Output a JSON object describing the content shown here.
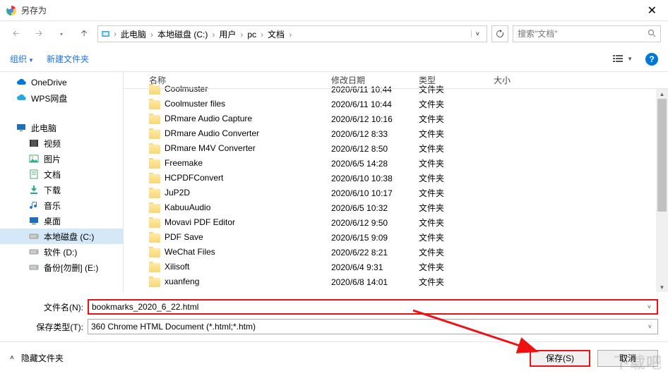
{
  "window": {
    "title": "另存为"
  },
  "breadcrumb": [
    "此电脑",
    "本地磁盘 (C:)",
    "用户",
    "pc",
    "文档"
  ],
  "search": {
    "placeholder": "搜索\"文档\""
  },
  "toolbar": {
    "organize": "组织",
    "newfolder": "新建文件夹"
  },
  "columns": {
    "name": "名称",
    "date": "修改日期",
    "type": "类型",
    "size": "大小"
  },
  "sidebar": [
    {
      "label": "OneDrive",
      "icon": "cloud",
      "color": "#0078d7"
    },
    {
      "label": "WPS网盘",
      "icon": "cloud",
      "color": "#2aa7e0"
    },
    {
      "label": "此电脑",
      "icon": "monitor",
      "color": "#1e6fb8"
    },
    {
      "label": "视频",
      "icon": "film",
      "color": "#555",
      "indent": true
    },
    {
      "label": "图片",
      "icon": "image",
      "color": "#3a9",
      "indent": true
    },
    {
      "label": "文档",
      "icon": "doc",
      "color": "#4a7",
      "indent": true
    },
    {
      "label": "下载",
      "icon": "download",
      "color": "#2a8",
      "indent": true
    },
    {
      "label": "音乐",
      "icon": "music",
      "color": "#27c",
      "indent": true
    },
    {
      "label": "桌面",
      "icon": "desktop",
      "color": "#1e6fb8",
      "indent": true
    },
    {
      "label": "本地磁盘 (C:)",
      "icon": "disk",
      "color": "#888",
      "indent": true,
      "selected": true
    },
    {
      "label": "软件 (D:)",
      "icon": "disk",
      "color": "#888",
      "indent": true
    },
    {
      "label": "备份[勿删] (E:)",
      "icon": "disk",
      "color": "#888",
      "indent": true
    }
  ],
  "files": [
    {
      "name": "Coolmuster",
      "date": "2020/6/11 10:44",
      "type": "文件夹"
    },
    {
      "name": "Coolmuster files",
      "date": "2020/6/11 10:44",
      "type": "文件夹"
    },
    {
      "name": "DRmare Audio Capture",
      "date": "2020/6/12 10:16",
      "type": "文件夹"
    },
    {
      "name": "DRmare Audio Converter",
      "date": "2020/6/12 8:33",
      "type": "文件夹"
    },
    {
      "name": "DRmare M4V Converter",
      "date": "2020/6/12 8:50",
      "type": "文件夹"
    },
    {
      "name": "Freemake",
      "date": "2020/6/5 14:28",
      "type": "文件夹"
    },
    {
      "name": "HCPDFConvert",
      "date": "2020/6/10 10:38",
      "type": "文件夹"
    },
    {
      "name": "JuP2D",
      "date": "2020/6/10 10:17",
      "type": "文件夹"
    },
    {
      "name": "KabuuAudio",
      "date": "2020/6/5 10:32",
      "type": "文件夹"
    },
    {
      "name": "Movavi PDF Editor",
      "date": "2020/6/12 9:50",
      "type": "文件夹"
    },
    {
      "name": "PDF Save",
      "date": "2020/6/15 9:09",
      "type": "文件夹"
    },
    {
      "name": "WeChat Files",
      "date": "2020/6/22 8:21",
      "type": "文件夹"
    },
    {
      "name": "Xilisoft",
      "date": "2020/6/4 9:31",
      "type": "文件夹"
    },
    {
      "name": "xuanfeng",
      "date": "2020/6/8 14:01",
      "type": "文件夹"
    }
  ],
  "form": {
    "filename_label": "文件名(N):",
    "filename_value": "bookmarks_2020_6_22.html",
    "filetype_label": "保存类型(T):",
    "filetype_value": "360 Chrome HTML Document (*.html;*.htm)"
  },
  "footer": {
    "hide_folders": "隐藏文件夹",
    "save": "保存(S)",
    "cancel": "取消"
  },
  "watermark": "下载吧"
}
